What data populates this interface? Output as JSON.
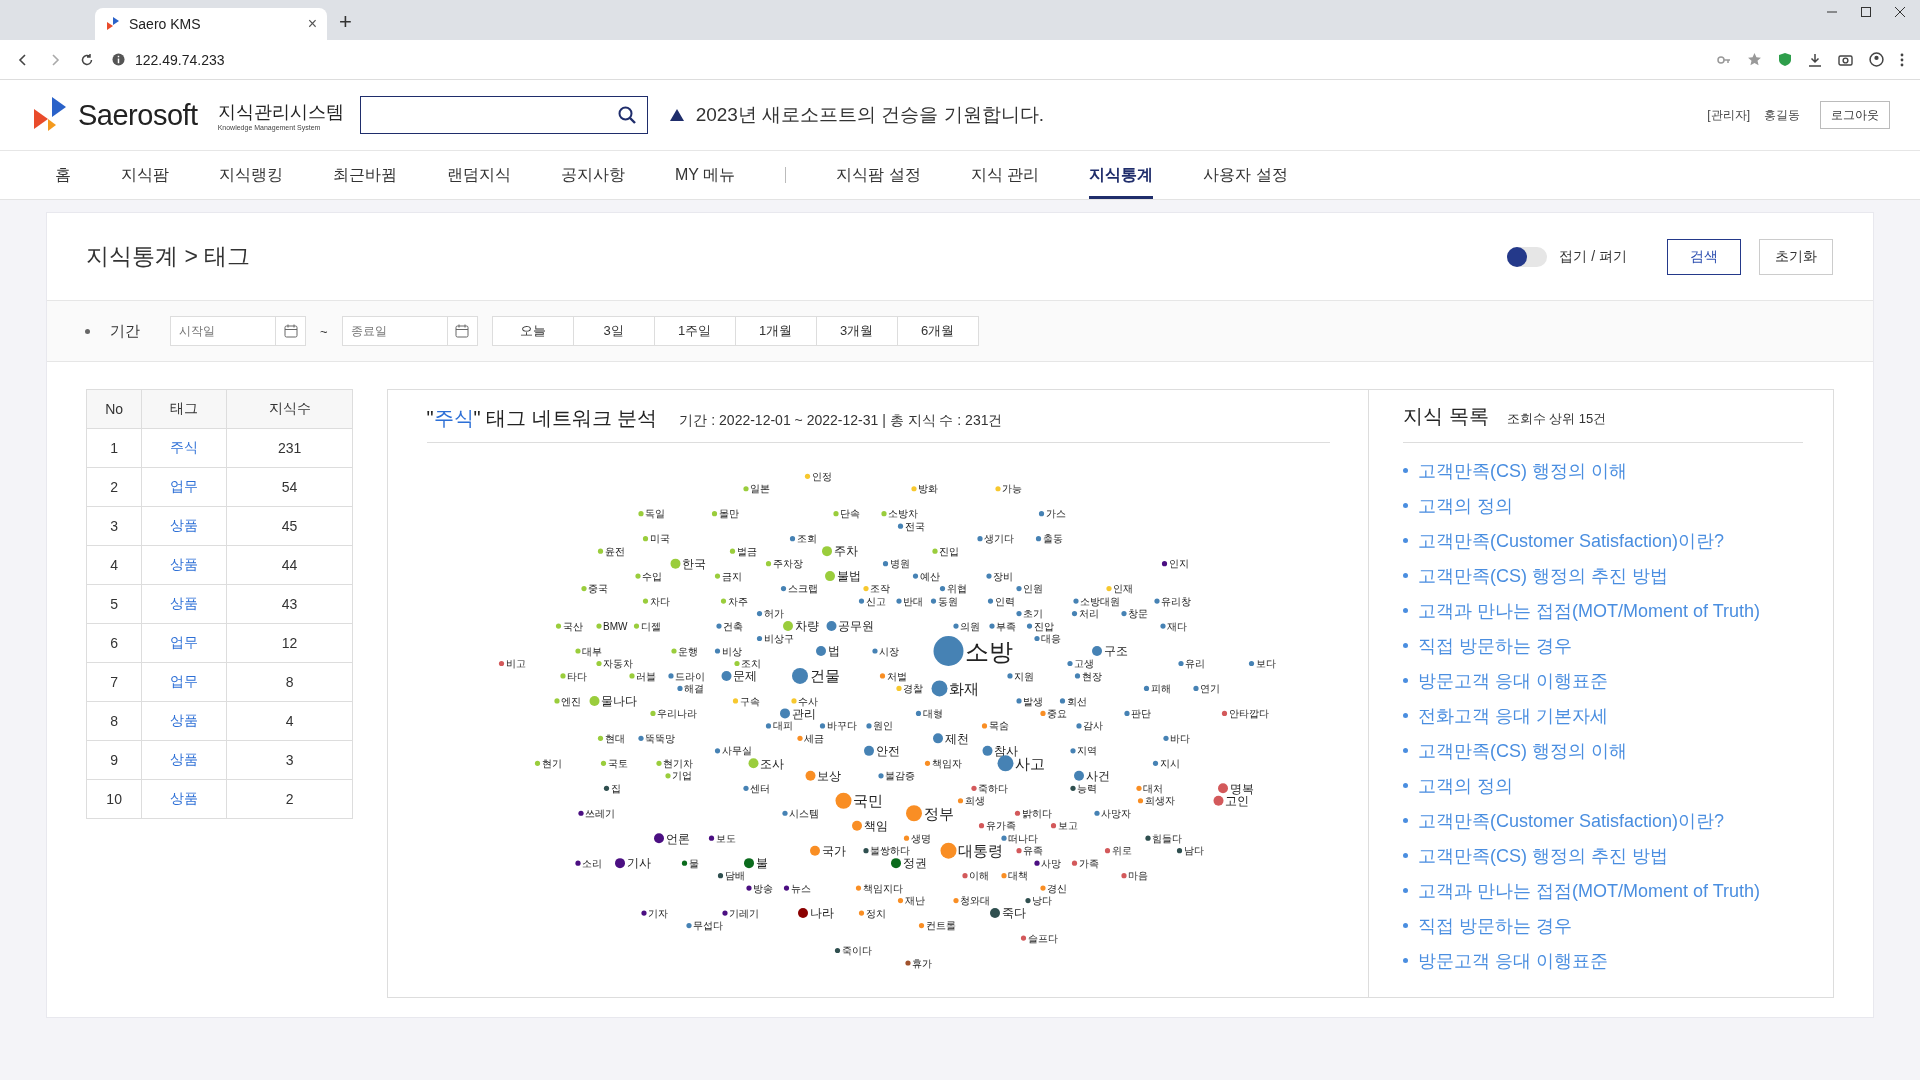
{
  "browser": {
    "tab_title": "Saero KMS",
    "new_tab": "+",
    "close_tab": "×",
    "url": "122.49.74.233"
  },
  "header": {
    "logo": "Saerosoft",
    "system_name": "지식관리시스템",
    "system_sub": "Knowledge Management System",
    "notice": "2023년 새로소프트의 건승을 기원합니다.",
    "user_role": "[관리자]",
    "user_name": "홍길동",
    "logout": "로그아웃"
  },
  "nav": [
    {
      "label": "홈",
      "selected": false
    },
    {
      "label": "지식팜",
      "selected": false
    },
    {
      "label": "지식랭킹",
      "selected": false
    },
    {
      "label": "최근바뀜",
      "selected": false
    },
    {
      "label": "랜덤지식",
      "selected": false
    },
    {
      "label": "공지사항",
      "selected": false
    },
    {
      "label": "MY 메뉴",
      "selected": false
    },
    {
      "label": "지식팜 설정",
      "selected": false
    },
    {
      "label": "지식 관리",
      "selected": false
    },
    {
      "label": "지식통계",
      "selected": true
    },
    {
      "label": "사용자 설정",
      "selected": false
    }
  ],
  "page": {
    "breadcrumb": "지식통계 > 태그",
    "toggle": {
      "label": "접기 / 펴기",
      "on": false
    },
    "search_button": "검색",
    "reset_button": "초기화"
  },
  "filter": {
    "label": "기간",
    "start": {
      "placeholder": "시작일"
    },
    "separator": "~",
    "end": {
      "placeholder": "종료일"
    },
    "ranges": [
      {
        "label": "오늘",
        "selected": false
      },
      {
        "label": "3일",
        "selected": false
      },
      {
        "label": "1주일",
        "selected": false
      },
      {
        "label": "1개월",
        "selected": false
      },
      {
        "label": "3개월",
        "selected": false
      },
      {
        "label": "6개월",
        "selected": false
      }
    ]
  },
  "table": {
    "columns": [
      "No",
      "태그",
      "지식수"
    ],
    "rows": [
      [
        "1",
        "주식",
        "231"
      ],
      [
        "2",
        "업무",
        "54"
      ],
      [
        "3",
        "상품",
        "45"
      ],
      [
        "4",
        "상품",
        "44"
      ],
      [
        "5",
        "상품",
        "43"
      ],
      [
        "6",
        "업무",
        "12"
      ],
      [
        "7",
        "업무",
        "8"
      ],
      [
        "8",
        "상품",
        "4"
      ],
      [
        "9",
        "상품",
        "3"
      ],
      [
        "10",
        "상품",
        "2"
      ]
    ]
  },
  "network": {
    "title_before": "\"",
    "tag": "주식",
    "title_after": "\" 태그 네트워크 분석",
    "meta": "기간 : 2022-12-01 ~ 2022-12-31  |  총 지식 수 : 231건",
    "nodes": [
      {
        "label": "인정",
        "color": "#f7c82e",
        "kind": "small"
      },
      {
        "label": "일본",
        "color": "#9acd3c",
        "kind": "small"
      },
      {
        "label": "방화",
        "color": "#f7c82e",
        "kind": "small"
      },
      {
        "label": "가능",
        "color": "#f7c82e",
        "kind": "small"
      },
      {
        "label": "독일",
        "color": "#9acd3c",
        "kind": "small"
      },
      {
        "label": "몰만",
        "color": "#9acd3c",
        "kind": "small"
      },
      {
        "label": "단속",
        "color": "#9acd3c",
        "kind": "small"
      },
      {
        "label": "소방차",
        "color": "#9acd3c",
        "kind": "small"
      },
      {
        "label": "가스",
        "color": "#4682b4",
        "kind": "small"
      },
      {
        "label": "전국",
        "color": "#4682b4",
        "kind": "small"
      },
      {
        "label": "미국",
        "color": "#9acd3c",
        "kind": "small"
      },
      {
        "label": "조회",
        "color": "#4682b4",
        "kind": "small"
      },
      {
        "label": "생기다",
        "color": "#4682b4",
        "kind": "small"
      },
      {
        "label": "출동",
        "color": "#4682b4",
        "kind": "small"
      },
      {
        "label": "윤전",
        "color": "#9acd3c",
        "kind": "small"
      },
      {
        "label": "벌금",
        "color": "#9acd3c",
        "kind": "small"
      },
      {
        "label": "주차",
        "color": "#9acd3c",
        "kind": "medium"
      },
      {
        "label": "진입",
        "color": "#9acd3c",
        "kind": "small"
      },
      {
        "label": "한국",
        "color": "#9acd3c",
        "kind": "medium"
      },
      {
        "label": "주차장",
        "color": "#9acd3c",
        "kind": "small"
      },
      {
        "label": "병원",
        "color": "#4682b4",
        "kind": "small"
      },
      {
        "label": "인지",
        "color": "#4b0f82",
        "kind": "small"
      },
      {
        "label": "수입",
        "color": "#9acd3c",
        "kind": "small"
      },
      {
        "label": "금지",
        "color": "#9acd3c",
        "kind": "small"
      },
      {
        "label": "불법",
        "color": "#9acd3c",
        "kind": "medium"
      },
      {
        "label": "예산",
        "color": "#4682b4",
        "kind": "small"
      },
      {
        "label": "장비",
        "color": "#4682b4",
        "kind": "small"
      },
      {
        "label": "중국",
        "color": "#9acd3c",
        "kind": "small"
      },
      {
        "label": "스크랩",
        "color": "#4682b4",
        "kind": "small"
      },
      {
        "label": "조작",
        "color": "#f7c82e",
        "kind": "small"
      },
      {
        "label": "위협",
        "color": "#4682b4",
        "kind": "small"
      },
      {
        "label": "인원",
        "color": "#4682b4",
        "kind": "small"
      },
      {
        "label": "인재",
        "color": "#f7c82e",
        "kind": "small"
      },
      {
        "label": "차다",
        "color": "#9acd3c",
        "kind": "small"
      },
      {
        "label": "차주",
        "color": "#9acd3c",
        "kind": "small"
      },
      {
        "label": "신고",
        "color": "#4682b4",
        "kind": "small"
      },
      {
        "label": "반대",
        "color": "#4682b4",
        "kind": "small"
      },
      {
        "label": "동원",
        "color": "#4682b4",
        "kind": "small"
      },
      {
        "label": "인력",
        "color": "#4682b4",
        "kind": "small"
      },
      {
        "label": "소방대원",
        "color": "#4682b4",
        "kind": "small"
      },
      {
        "label": "유리창",
        "color": "#4682b4",
        "kind": "small"
      },
      {
        "label": "허가",
        "color": "#4682b4",
        "kind": "small"
      },
      {
        "label": "초기",
        "color": "#4682b4",
        "kind": "small"
      },
      {
        "label": "처리",
        "color": "#4682b4",
        "kind": "small"
      },
      {
        "label": "창문",
        "color": "#4682b4",
        "kind": "small"
      },
      {
        "label": "국산",
        "color": "#9acd3c",
        "kind": "small"
      },
      {
        "label": "BMW",
        "color": "#9acd3c",
        "kind": "small"
      },
      {
        "label": "디젤",
        "color": "#9acd3c",
        "kind": "small"
      },
      {
        "label": "건축",
        "color": "#4682b4",
        "kind": "small"
      },
      {
        "label": "차량",
        "color": "#9acd3c",
        "kind": "medium"
      },
      {
        "label": "공무원",
        "color": "#4682b4",
        "kind": "medium"
      },
      {
        "label": "의원",
        "color": "#4682b4",
        "kind": "small"
      },
      {
        "label": "부족",
        "color": "#4682b4",
        "kind": "small"
      },
      {
        "label": "진압",
        "color": "#4682b4",
        "kind": "small"
      },
      {
        "label": "재다",
        "color": "#4682b4",
        "kind": "small"
      },
      {
        "label": "비상구",
        "color": "#4682b4",
        "kind": "small"
      },
      {
        "label": "대응",
        "color": "#4682b4",
        "kind": "small"
      },
      {
        "label": "대부",
        "color": "#9acd3c",
        "kind": "small"
      },
      {
        "label": "운행",
        "color": "#9acd3c",
        "kind": "small"
      },
      {
        "label": "비상",
        "color": "#4682b4",
        "kind": "small"
      },
      {
        "label": "법",
        "color": "#4682b4",
        "kind": "medium"
      },
      {
        "label": "시장",
        "color": "#4682b4",
        "kind": "small"
      },
      {
        "label": "소방",
        "color": "#4682b4",
        "kind": "huge"
      },
      {
        "label": "구조",
        "color": "#4682b4",
        "kind": "medium"
      },
      {
        "label": "비고",
        "color": "#d3595b",
        "kind": "small"
      },
      {
        "label": "자동차",
        "color": "#9acd3c",
        "kind": "small"
      },
      {
        "label": "조치",
        "color": "#9acd3c",
        "kind": "small"
      },
      {
        "label": "고생",
        "color": "#4682b4",
        "kind": "small"
      },
      {
        "label": "유리",
        "color": "#4682b4",
        "kind": "small"
      },
      {
        "label": "보다",
        "color": "#4682b4",
        "kind": "small"
      },
      {
        "label": "타다",
        "color": "#9acd3c",
        "kind": "small"
      },
      {
        "label": "러블",
        "color": "#9acd3c",
        "kind": "small"
      },
      {
        "label": "드라이",
        "color": "#4682b4",
        "kind": "small"
      },
      {
        "label": "문제",
        "color": "#4682b4",
        "kind": "medium"
      },
      {
        "label": "건물",
        "color": "#4682b4",
        "kind": "large"
      },
      {
        "label": "처벌",
        "color": "#f98e24",
        "kind": "small"
      },
      {
        "label": "지원",
        "color": "#4682b4",
        "kind": "small"
      },
      {
        "label": "현장",
        "color": "#4682b4",
        "kind": "small"
      },
      {
        "label": "해결",
        "color": "#4682b4",
        "kind": "small"
      },
      {
        "label": "경찰",
        "color": "#f7c82e",
        "kind": "small"
      },
      {
        "label": "화재",
        "color": "#4682b4",
        "kind": "large"
      },
      {
        "label": "피해",
        "color": "#4682b4",
        "kind": "small"
      },
      {
        "label": "연기",
        "color": "#4682b4",
        "kind": "small"
      },
      {
        "label": "엔진",
        "color": "#9acd3c",
        "kind": "small"
      },
      {
        "label": "물나다",
        "color": "#9acd3c",
        "kind": "medium"
      },
      {
        "label": "구속",
        "color": "#f7c82e",
        "kind": "small"
      },
      {
        "label": "수사",
        "color": "#f7c82e",
        "kind": "small"
      },
      {
        "label": "발생",
        "color": "#4682b4",
        "kind": "small"
      },
      {
        "label": "회선",
        "color": "#4682b4",
        "kind": "small"
      },
      {
        "label": "우리나라",
        "color": "#9acd3c",
        "kind": "small"
      },
      {
        "label": "관리",
        "color": "#4682b4",
        "kind": "medium"
      },
      {
        "label": "대형",
        "color": "#4682b4",
        "kind": "small"
      },
      {
        "label": "중요",
        "color": "#f98e24",
        "kind": "small"
      },
      {
        "label": "판단",
        "color": "#4682b4",
        "kind": "small"
      },
      {
        "label": "안타깝다",
        "color": "#d3595b",
        "kind": "small"
      },
      {
        "label": "대피",
        "color": "#4682b4",
        "kind": "small"
      },
      {
        "label": "바꾸다",
        "color": "#4682b4",
        "kind": "small"
      },
      {
        "label": "원인",
        "color": "#4682b4",
        "kind": "small"
      },
      {
        "label": "목숨",
        "color": "#f98e24",
        "kind": "small"
      },
      {
        "label": "감사",
        "color": "#4682b4",
        "kind": "small"
      },
      {
        "label": "현대",
        "color": "#9acd3c",
        "kind": "small"
      },
      {
        "label": "뚝뚝망",
        "color": "#4682b4",
        "kind": "small"
      },
      {
        "label": "세금",
        "color": "#f98e24",
        "kind": "small"
      },
      {
        "label": "제천",
        "color": "#4682b4",
        "kind": "medium"
      },
      {
        "label": "바다",
        "color": "#4682b4",
        "kind": "small"
      },
      {
        "label": "사무실",
        "color": "#4682b4",
        "kind": "small"
      },
      {
        "label": "안전",
        "color": "#4682b4",
        "kind": "medium"
      },
      {
        "label": "참사",
        "color": "#4682b4",
        "kind": "medium"
      },
      {
        "label": "지역",
        "color": "#4682b4",
        "kind": "small"
      },
      {
        "label": "현기",
        "color": "#9acd3c",
        "kind": "small"
      },
      {
        "label": "국토",
        "color": "#9acd3c",
        "kind": "small"
      },
      {
        "label": "현기차",
        "color": "#9acd3c",
        "kind": "small"
      },
      {
        "label": "조사",
        "color": "#9acd3c",
        "kind": "medium"
      },
      {
        "label": "책임자",
        "color": "#f98e24",
        "kind": "small"
      },
      {
        "label": "사고",
        "color": "#4682b4",
        "kind": "large"
      },
      {
        "label": "지시",
        "color": "#4682b4",
        "kind": "small"
      },
      {
        "label": "기업",
        "color": "#9acd3c",
        "kind": "small"
      },
      {
        "label": "보상",
        "color": "#f98e24",
        "kind": "medium"
      },
      {
        "label": "불감증",
        "color": "#4682b4",
        "kind": "small"
      },
      {
        "label": "사건",
        "color": "#4682b4",
        "kind": "medium"
      },
      {
        "label": "집",
        "color": "#2f4f4f",
        "kind": "small"
      },
      {
        "label": "센터",
        "color": "#4682b4",
        "kind": "small"
      },
      {
        "label": "죽하다",
        "color": "#d3595b",
        "kind": "small"
      },
      {
        "label": "능력",
        "color": "#2f4f4f",
        "kind": "small"
      },
      {
        "label": "대처",
        "color": "#f98e24",
        "kind": "small"
      },
      {
        "label": "명복",
        "color": "#d3595b",
        "kind": "medium"
      },
      {
        "label": "국민",
        "color": "#f98e24",
        "kind": "large"
      },
      {
        "label": "희생",
        "color": "#f98e24",
        "kind": "small"
      },
      {
        "label": "희생자",
        "color": "#f98e24",
        "kind": "small"
      },
      {
        "label": "고인",
        "color": "#d3595b",
        "kind": "medium"
      },
      {
        "label": "쓰레기",
        "color": "#4b0f82",
        "kind": "small"
      },
      {
        "label": "시스템",
        "color": "#4682b4",
        "kind": "small"
      },
      {
        "label": "정부",
        "color": "#f98e24",
        "kind": "large"
      },
      {
        "label": "밝히다",
        "color": "#d3595b",
        "kind": "small"
      },
      {
        "label": "사망자",
        "color": "#4682b4",
        "kind": "small"
      },
      {
        "label": "책임",
        "color": "#f98e24",
        "kind": "medium"
      },
      {
        "label": "유가족",
        "color": "#d3595b",
        "kind": "small"
      },
      {
        "label": "보고",
        "color": "#d3595b",
        "kind": "small"
      },
      {
        "label": "언론",
        "color": "#4b0f82",
        "kind": "medium"
      },
      {
        "label": "보도",
        "color": "#4b0f82",
        "kind": "small"
      },
      {
        "label": "생명",
        "color": "#f98e24",
        "kind": "small"
      },
      {
        "label": "떠나다",
        "color": "#4682b4",
        "kind": "small"
      },
      {
        "label": "힘들다",
        "color": "#2f4f4f",
        "kind": "small"
      },
      {
        "label": "국가",
        "color": "#f98e24",
        "kind": "medium"
      },
      {
        "label": "불쌍하다",
        "color": "#2f4f4f",
        "kind": "small"
      },
      {
        "label": "대통령",
        "color": "#f98e24",
        "kind": "large"
      },
      {
        "label": "유족",
        "color": "#d3595b",
        "kind": "small"
      },
      {
        "label": "위로",
        "color": "#d3595b",
        "kind": "small"
      },
      {
        "label": "남다",
        "color": "#2f4f4f",
        "kind": "small"
      },
      {
        "label": "소리",
        "color": "#4b0f82",
        "kind": "small"
      },
      {
        "label": "기사",
        "color": "#4b0f82",
        "kind": "medium"
      },
      {
        "label": "물",
        "color": "#0b6b1d",
        "kind": "small"
      },
      {
        "label": "불",
        "color": "#0b6b1d",
        "kind": "medium"
      },
      {
        "label": "정권",
        "color": "#0b6b1d",
        "kind": "medium"
      },
      {
        "label": "사망",
        "color": "#4b0f82",
        "kind": "small"
      },
      {
        "label": "가족",
        "color": "#d3595b",
        "kind": "small"
      },
      {
        "label": "담배",
        "color": "#2f4f4f",
        "kind": "small"
      },
      {
        "label": "이해",
        "color": "#d3595b",
        "kind": "small"
      },
      {
        "label": "대책",
        "color": "#f98e24",
        "kind": "small"
      },
      {
        "label": "마음",
        "color": "#d3595b",
        "kind": "small"
      },
      {
        "label": "방송",
        "color": "#4b0f82",
        "kind": "small"
      },
      {
        "label": "뉴스",
        "color": "#4b0f82",
        "kind": "small"
      },
      {
        "label": "책임지다",
        "color": "#f98e24",
        "kind": "small"
      },
      {
        "label": "경신",
        "color": "#f98e24",
        "kind": "small"
      },
      {
        "label": "재난",
        "color": "#f98e24",
        "kind": "small"
      },
      {
        "label": "청와대",
        "color": "#f98e24",
        "kind": "small"
      },
      {
        "label": "낭다",
        "color": "#2f4f4f",
        "kind": "small"
      },
      {
        "label": "기자",
        "color": "#4b0f82",
        "kind": "small"
      },
      {
        "label": "기레기",
        "color": "#4b0f82",
        "kind": "small"
      },
      {
        "label": "나라",
        "color": "#8b0000",
        "kind": "medium"
      },
      {
        "label": "정치",
        "color": "#f98e24",
        "kind": "small"
      },
      {
        "label": "죽다",
        "color": "#2f4f4f",
        "kind": "medium"
      },
      {
        "label": "무섭다",
        "color": "#4682b4",
        "kind": "small"
      },
      {
        "label": "컨트롤",
        "color": "#f98e24",
        "kind": "small"
      },
      {
        "label": "슬프다",
        "color": "#d3595b",
        "kind": "small"
      },
      {
        "label": "죽이다",
        "color": "#2f4f4f",
        "kind": "small"
      },
      {
        "label": "휴가",
        "color": "#a0522d",
        "kind": "small"
      }
    ]
  },
  "knowledge": {
    "title": "지식 목록",
    "subtitle": "조회수 상위 15건",
    "items": [
      "고객만족(CS) 행정의 이해",
      "고객의 정의",
      "고객만족(Customer Satisfaction)이란?",
      "고객만족(CS) 행정의 추진 방법",
      "고객과 만나는 접점(MOT/Moment of Truth)",
      "직접 방문하는 경우",
      "방문고객 응대 이행표준",
      "전화고객 응대 기본자세",
      "고객만족(CS) 행정의 이해",
      "고객의 정의",
      "고객만족(Customer Satisfaction)이란?",
      "고객만족(CS) 행정의 추진 방법",
      "고객과 만나는 접점(MOT/Moment of Truth)",
      "직접 방문하는 경우",
      "방문고객 응대 이행표준"
    ]
  }
}
